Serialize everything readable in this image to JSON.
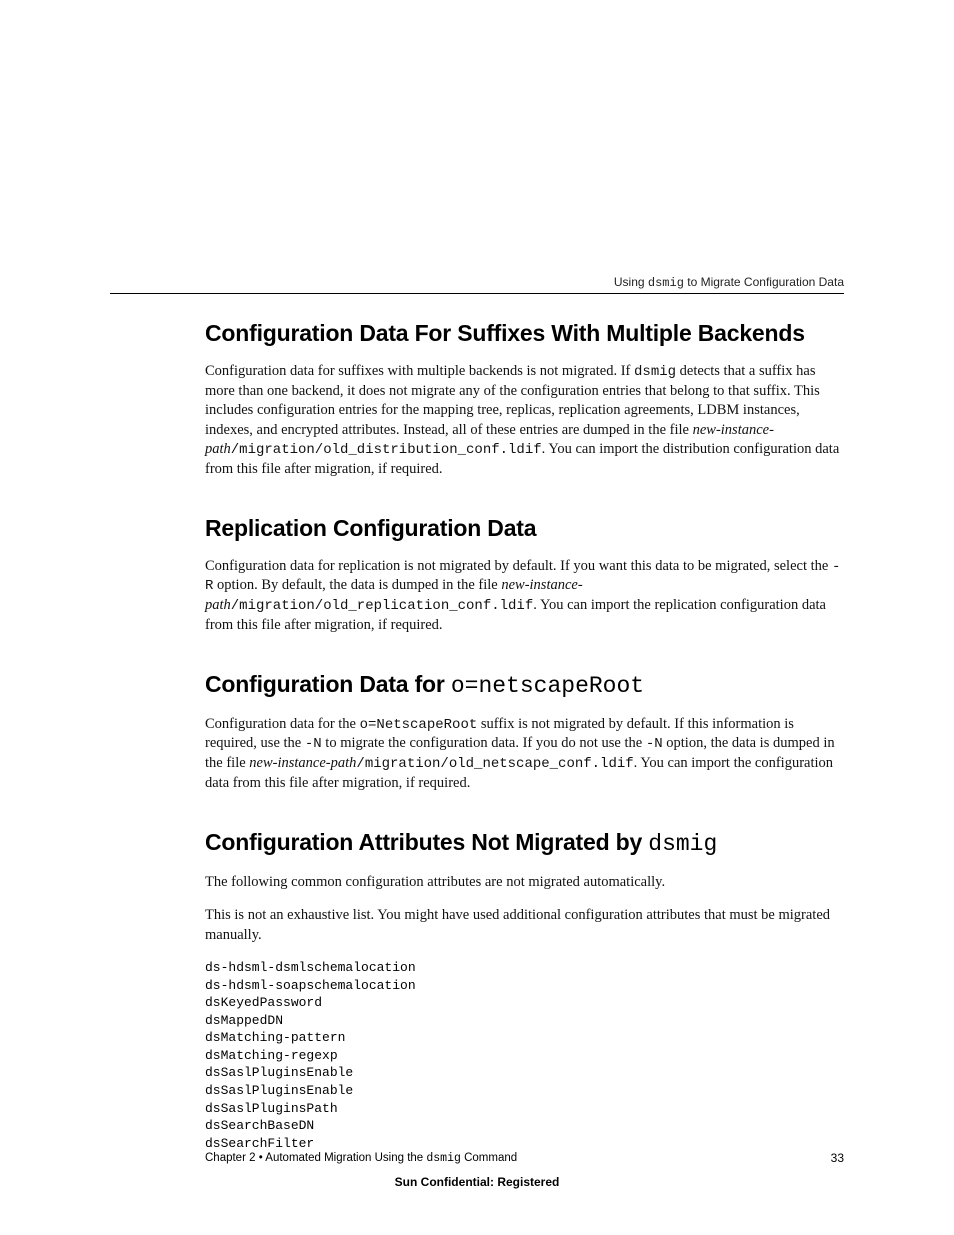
{
  "runningHead": {
    "prefix": "Using ",
    "cmd": "dsmig",
    "suffix": " to Migrate Configuration Data"
  },
  "sections": {
    "s1": {
      "title": "Configuration Data For Suffixes With Multiple Backends",
      "p1a": "Configuration data for suffixes with multiple backends is not migrated. If ",
      "p1b": "dsmig",
      "p1c": " detects that a suffix has more than one backend, it does not migrate any of the configuration entries that belong to that suffix. This includes configuration entries for the mapping tree, replicas, replication agreements, LDBM instances, indexes, and encrypted attributes. Instead, all of these entries are dumped in the file ",
      "p1d": "new-instance-path",
      "p1e": "/migration/old_distribution_conf.ldif",
      "p1f": ". You can import the distribution configuration data from this file after migration, if required."
    },
    "s2": {
      "title": "Replication Configuration Data",
      "p1a": "Configuration data for replication is not migrated by default. If you want this data to be migrated, select the ",
      "p1b": "-R",
      "p1c": " option. By default, the data is dumped in the file ",
      "p1d": "new-instance-path",
      "p1e": "/migration/old_replication_conf.ldif",
      "p1f": ". You can import the replication configuration data from this file after migration, if required."
    },
    "s3": {
      "titlePrefix": "Configuration Data for ",
      "titleCode": "o=netscapeRoot",
      "p1a": "Configuration data for the ",
      "p1b": "o=NetscapeRoot",
      "p1c": " suffix is not migrated by default. If this information is required, use the ",
      "p1d": "-N",
      "p1e": " to migrate the configuration data. If you do not use the ",
      "p1f": "-N",
      "p1g": " option, the data is dumped in the file ",
      "p1h": "new-instance-path",
      "p1i": "/migration/old_netscape_conf.ldif",
      "p1j": ". You can import the configuration data from this file after migration, if required."
    },
    "s4": {
      "titlePrefix": "Configuration Attributes Not Migrated by ",
      "titleCode": "dsmig",
      "p1": "The following common configuration attributes are not migrated automatically.",
      "p2": "This is not an exhaustive list. You might have used additional configuration attributes that must be migrated manually.",
      "attrs": "ds-hdsml-dsmlschemalocation\nds-hdsml-soapschemalocation\ndsKeyedPassword\ndsMappedDN\ndsMatching-pattern\ndsMatching-regexp\ndsSaslPluginsEnable\ndsSaslPluginsEnable\ndsSaslPluginsPath\ndsSearchBaseDN\ndsSearchFilter"
    }
  },
  "footer": {
    "leftPrefix": "Chapter 2  •  Automated Migration Using the ",
    "leftCode": "dsmig",
    "leftSuffix": " Command",
    "page": "33",
    "confidential": "Sun Confidential: Registered"
  }
}
